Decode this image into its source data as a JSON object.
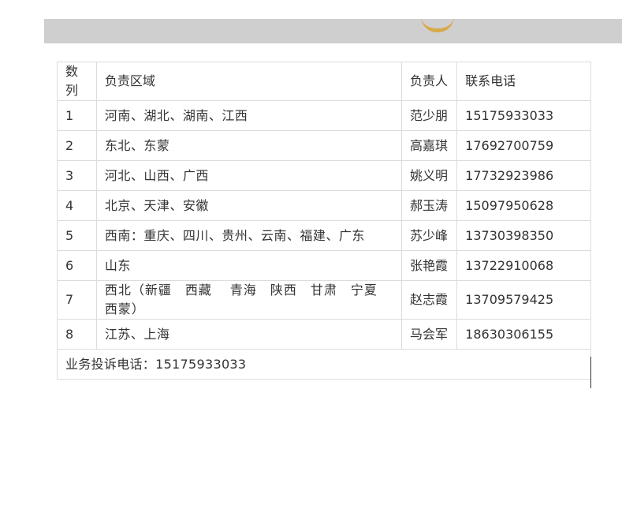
{
  "table": {
    "headers": {
      "index": "数列",
      "region": "负责区域",
      "person": "负责人",
      "phone": "联系电话"
    },
    "rows": [
      {
        "index": "1",
        "region": "河南、湖北、湖南、江西",
        "person": "范少朋",
        "phone": "15175933033"
      },
      {
        "index": "2",
        "region": "东北、东蒙",
        "person": "高嘉琪",
        "phone": "17692700759"
      },
      {
        "index": "3",
        "region": "河北、山西、广西",
        "person": "姚义明",
        "phone": "17732923986"
      },
      {
        "index": "4",
        "region": "北京、天津、安徽",
        "person": "郝玉涛",
        "phone": "15097950628"
      },
      {
        "index": "5",
        "region": "西南：重庆、四川、贵州、云南、福建、广东",
        "person": "苏少峰",
        "phone": "13730398350"
      },
      {
        "index": "6",
        "region": "山东",
        "person": "张艳霞",
        "phone": "13722910068"
      },
      {
        "index": "7",
        "region": "西北（新疆　西藏　 青海　陕西　甘肃　宁夏　西蒙）",
        "person": "赵志霞",
        "phone": "13709579425"
      },
      {
        "index": "8",
        "region": "江苏、上海",
        "person": "马会军",
        "phone": "18630306155"
      }
    ],
    "footer": "业务投诉电话：15175933033"
  }
}
